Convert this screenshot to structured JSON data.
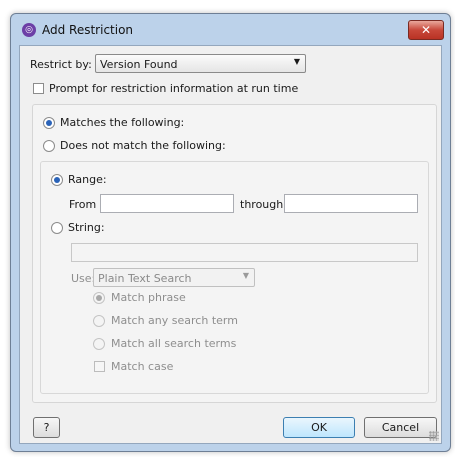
{
  "window": {
    "title": "Add Restriction",
    "close_glyph": "✕",
    "icon": "app-icon"
  },
  "restrict_by": {
    "label": "Restrict by:",
    "selected": "Version Found",
    "arrow": "▼"
  },
  "prompt_checkbox": {
    "label": "Prompt for restriction information at run time",
    "checked": false
  },
  "match_mode": {
    "matches_label": "Matches the following:",
    "not_match_label": "Does not match the following:",
    "selected": "matches"
  },
  "range": {
    "label": "Range:",
    "from_label": "From",
    "through_label": "through",
    "from_value": "",
    "through_value": "",
    "selected": true
  },
  "string": {
    "label": "String:",
    "value": "",
    "use_label": "Use:",
    "use_selected": "Plain Text Search",
    "arrow": "▼",
    "options": {
      "match_phrase": "Match phrase",
      "match_any": "Match any search term",
      "match_all": "Match all search terms",
      "match_case": "Match case"
    }
  },
  "buttons": {
    "help": "?",
    "ok": "OK",
    "cancel": "Cancel"
  }
}
